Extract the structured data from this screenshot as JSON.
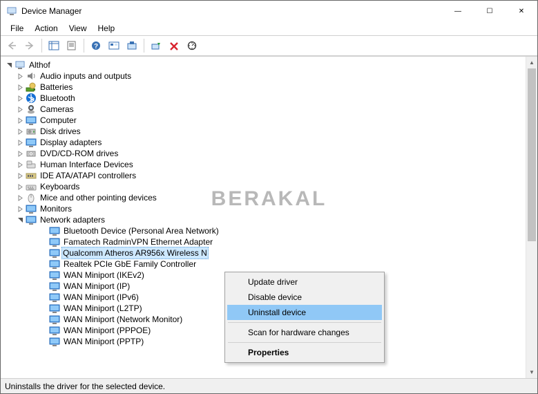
{
  "title": "Device Manager",
  "menus": [
    "File",
    "Action",
    "View",
    "Help"
  ],
  "toolbar": [
    {
      "id": "back",
      "enabled": false
    },
    {
      "id": "forward",
      "enabled": false
    },
    {
      "id": "|"
    },
    {
      "id": "show-hide-tree",
      "enabled": true
    },
    {
      "id": "properties",
      "enabled": true
    },
    {
      "id": "|"
    },
    {
      "id": "help",
      "enabled": true
    },
    {
      "id": "show-hidden",
      "enabled": true
    },
    {
      "id": "update-driver",
      "enabled": true
    },
    {
      "id": "|"
    },
    {
      "id": "enable-device",
      "enabled": true
    },
    {
      "id": "uninstall-device",
      "enabled": true
    },
    {
      "id": "scan-hardware",
      "enabled": true
    }
  ],
  "root": {
    "label": "Althof",
    "icon": "computer"
  },
  "categories": [
    {
      "label": "Audio inputs and outputs",
      "icon": "audio",
      "exp": "closed"
    },
    {
      "label": "Batteries",
      "icon": "battery",
      "exp": "closed"
    },
    {
      "label": "Bluetooth",
      "icon": "bluetooth",
      "exp": "closed"
    },
    {
      "label": "Cameras",
      "icon": "camera",
      "exp": "closed"
    },
    {
      "label": "Computer",
      "icon": "monitor",
      "exp": "closed"
    },
    {
      "label": "Disk drives",
      "icon": "disk",
      "exp": "closed"
    },
    {
      "label": "Display adapters",
      "icon": "monitor",
      "exp": "closed"
    },
    {
      "label": "DVD/CD-ROM drives",
      "icon": "dvd",
      "exp": "closed"
    },
    {
      "label": "Human Interface Devices",
      "icon": "hid",
      "exp": "closed"
    },
    {
      "label": "IDE ATA/ATAPI controllers",
      "icon": "ide",
      "exp": "closed"
    },
    {
      "label": "Keyboards",
      "icon": "keyboard",
      "exp": "closed"
    },
    {
      "label": "Mice and other pointing devices",
      "icon": "mouse",
      "exp": "closed"
    },
    {
      "label": "Monitors",
      "icon": "monitor",
      "exp": "closed"
    },
    {
      "label": "Network adapters",
      "icon": "monitor",
      "exp": "open"
    }
  ],
  "network_children": [
    {
      "label": "Bluetooth Device (Personal Area Network)"
    },
    {
      "label": "Famatech RadminVPN Ethernet Adapter"
    },
    {
      "label": "Qualcomm Atheros AR956x Wireless N",
      "selected": true
    },
    {
      "label": "Realtek PCIe GbE Family Controller"
    },
    {
      "label": "WAN Miniport (IKEv2)"
    },
    {
      "label": "WAN Miniport (IP)"
    },
    {
      "label": "WAN Miniport (IPv6)"
    },
    {
      "label": "WAN Miniport (L2TP)"
    },
    {
      "label": "WAN Miniport (Network Monitor)"
    },
    {
      "label": "WAN Miniport (PPPOE)"
    },
    {
      "label": "WAN Miniport (PPTP)"
    }
  ],
  "context_menu": [
    {
      "label": "Update driver"
    },
    {
      "label": "Disable device"
    },
    {
      "label": "Uninstall device",
      "hover": true
    },
    {
      "sep": true
    },
    {
      "label": "Scan for hardware changes"
    },
    {
      "sep": true
    },
    {
      "label": "Properties",
      "bold": true
    }
  ],
  "statusbar": "Uninstalls the driver for the selected device.",
  "watermark": "BERAKAL",
  "win_buttons": {
    "min": "—",
    "max": "☐",
    "close": "✕"
  }
}
